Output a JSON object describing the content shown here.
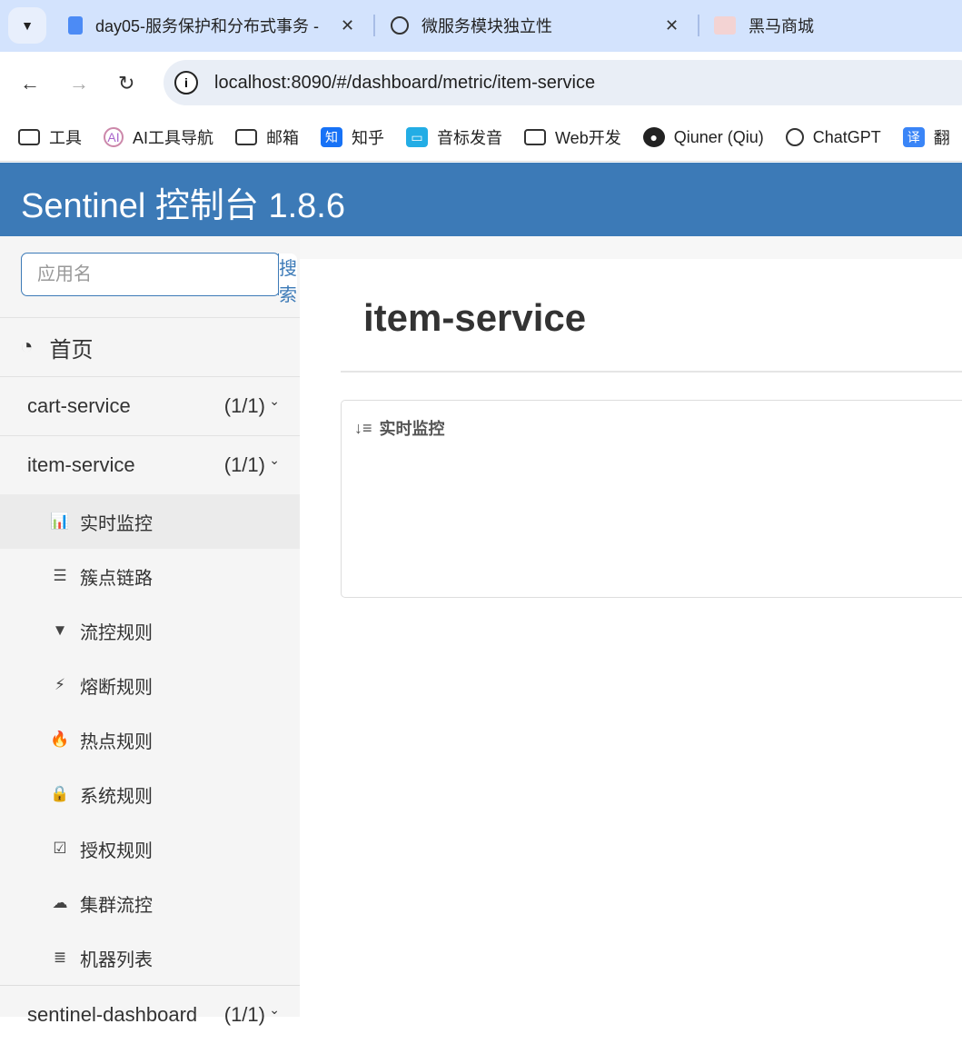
{
  "browser": {
    "tabs": [
      {
        "title": "day05-服务保护和分布式事务 -",
        "icon": "docs-icon",
        "color": "#4c8bf5"
      },
      {
        "title": "微服务模块独立性",
        "icon": "chatgpt-icon"
      },
      {
        "title": "黑马商城",
        "icon": "site-favicon"
      }
    ],
    "url": "localhost:8090/#/dashboard/metric/item-service",
    "bookmarks": [
      "工具",
      "AI工具导航",
      "邮箱",
      "知乎",
      "音标发音",
      "Web开发",
      "Qiuner (Qiu)",
      "ChatGPT",
      "翻"
    ]
  },
  "header": {
    "title": "Sentinel 控制台 1.8.6"
  },
  "sidebar": {
    "search_placeholder": "应用名",
    "search_button": "搜索",
    "home": "首页",
    "apps": [
      {
        "name": "cart-service",
        "count": "(1/1)"
      },
      {
        "name": "item-service",
        "count": "(1/1)"
      },
      {
        "name": "sentinel-dashboard",
        "count": "(1/1)"
      }
    ],
    "submenu": [
      {
        "label": "实时监控",
        "icon": "bar-chart-icon",
        "glyph": "📊"
      },
      {
        "label": "簇点链路",
        "icon": "list-alt-icon",
        "glyph": "☰"
      },
      {
        "label": "流控规则",
        "icon": "filter-icon",
        "glyph": "▼"
      },
      {
        "label": "熔断规则",
        "icon": "flash-icon",
        "glyph": "⚡"
      },
      {
        "label": "热点规则",
        "icon": "fire-icon",
        "glyph": "🔥"
      },
      {
        "label": "系统规则",
        "icon": "lock-icon",
        "glyph": "🔒"
      },
      {
        "label": "授权规则",
        "icon": "check-square-icon",
        "glyph": "☑"
      },
      {
        "label": "集群流控",
        "icon": "cloud-icon",
        "glyph": "☁"
      },
      {
        "label": "机器列表",
        "icon": "th-list-icon",
        "glyph": "≣"
      }
    ]
  },
  "main": {
    "title": "item-service",
    "panel_title": "实时监控"
  }
}
